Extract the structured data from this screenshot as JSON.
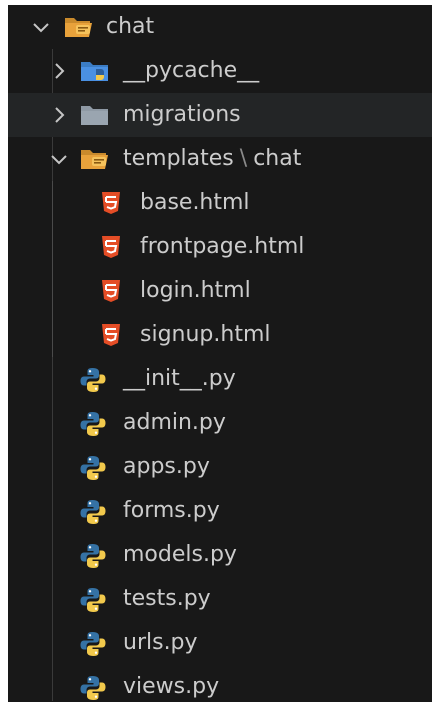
{
  "explorer": {
    "root": {
      "label": "chat",
      "icon": "chat-folder-open-icon",
      "expanded": true
    },
    "items": [
      {
        "label": "__pycache__",
        "icon": "python-folder-icon",
        "expanded": false
      },
      {
        "label": "migrations",
        "icon": "folder-icon",
        "expanded": false
      },
      {
        "label_parts": [
          "templates",
          "\\",
          "chat"
        ],
        "icon": "chat-folder-open-icon",
        "expanded": true
      },
      {
        "label": "base.html",
        "icon": "html5-icon"
      },
      {
        "label": "frontpage.html",
        "icon": "html5-icon"
      },
      {
        "label": "login.html",
        "icon": "html5-icon"
      },
      {
        "label": "signup.html",
        "icon": "html5-icon"
      },
      {
        "label": "__init__.py",
        "icon": "python-icon"
      },
      {
        "label": "admin.py",
        "icon": "python-icon"
      },
      {
        "label": "apps.py",
        "icon": "python-icon"
      },
      {
        "label": "forms.py",
        "icon": "python-icon"
      },
      {
        "label": "models.py",
        "icon": "python-icon"
      },
      {
        "label": "tests.py",
        "icon": "python-icon"
      },
      {
        "label": "urls.py",
        "icon": "python-icon"
      },
      {
        "label": "views.py",
        "icon": "python-icon"
      }
    ]
  },
  "colors": {
    "background": "#181818",
    "text": "#cccccc",
    "folder_orange": "#e8a23b",
    "html_orange": "#e44d26",
    "python_blue": "#3572a5",
    "python_yellow": "#f2c94c",
    "hover_row": "#232526"
  }
}
